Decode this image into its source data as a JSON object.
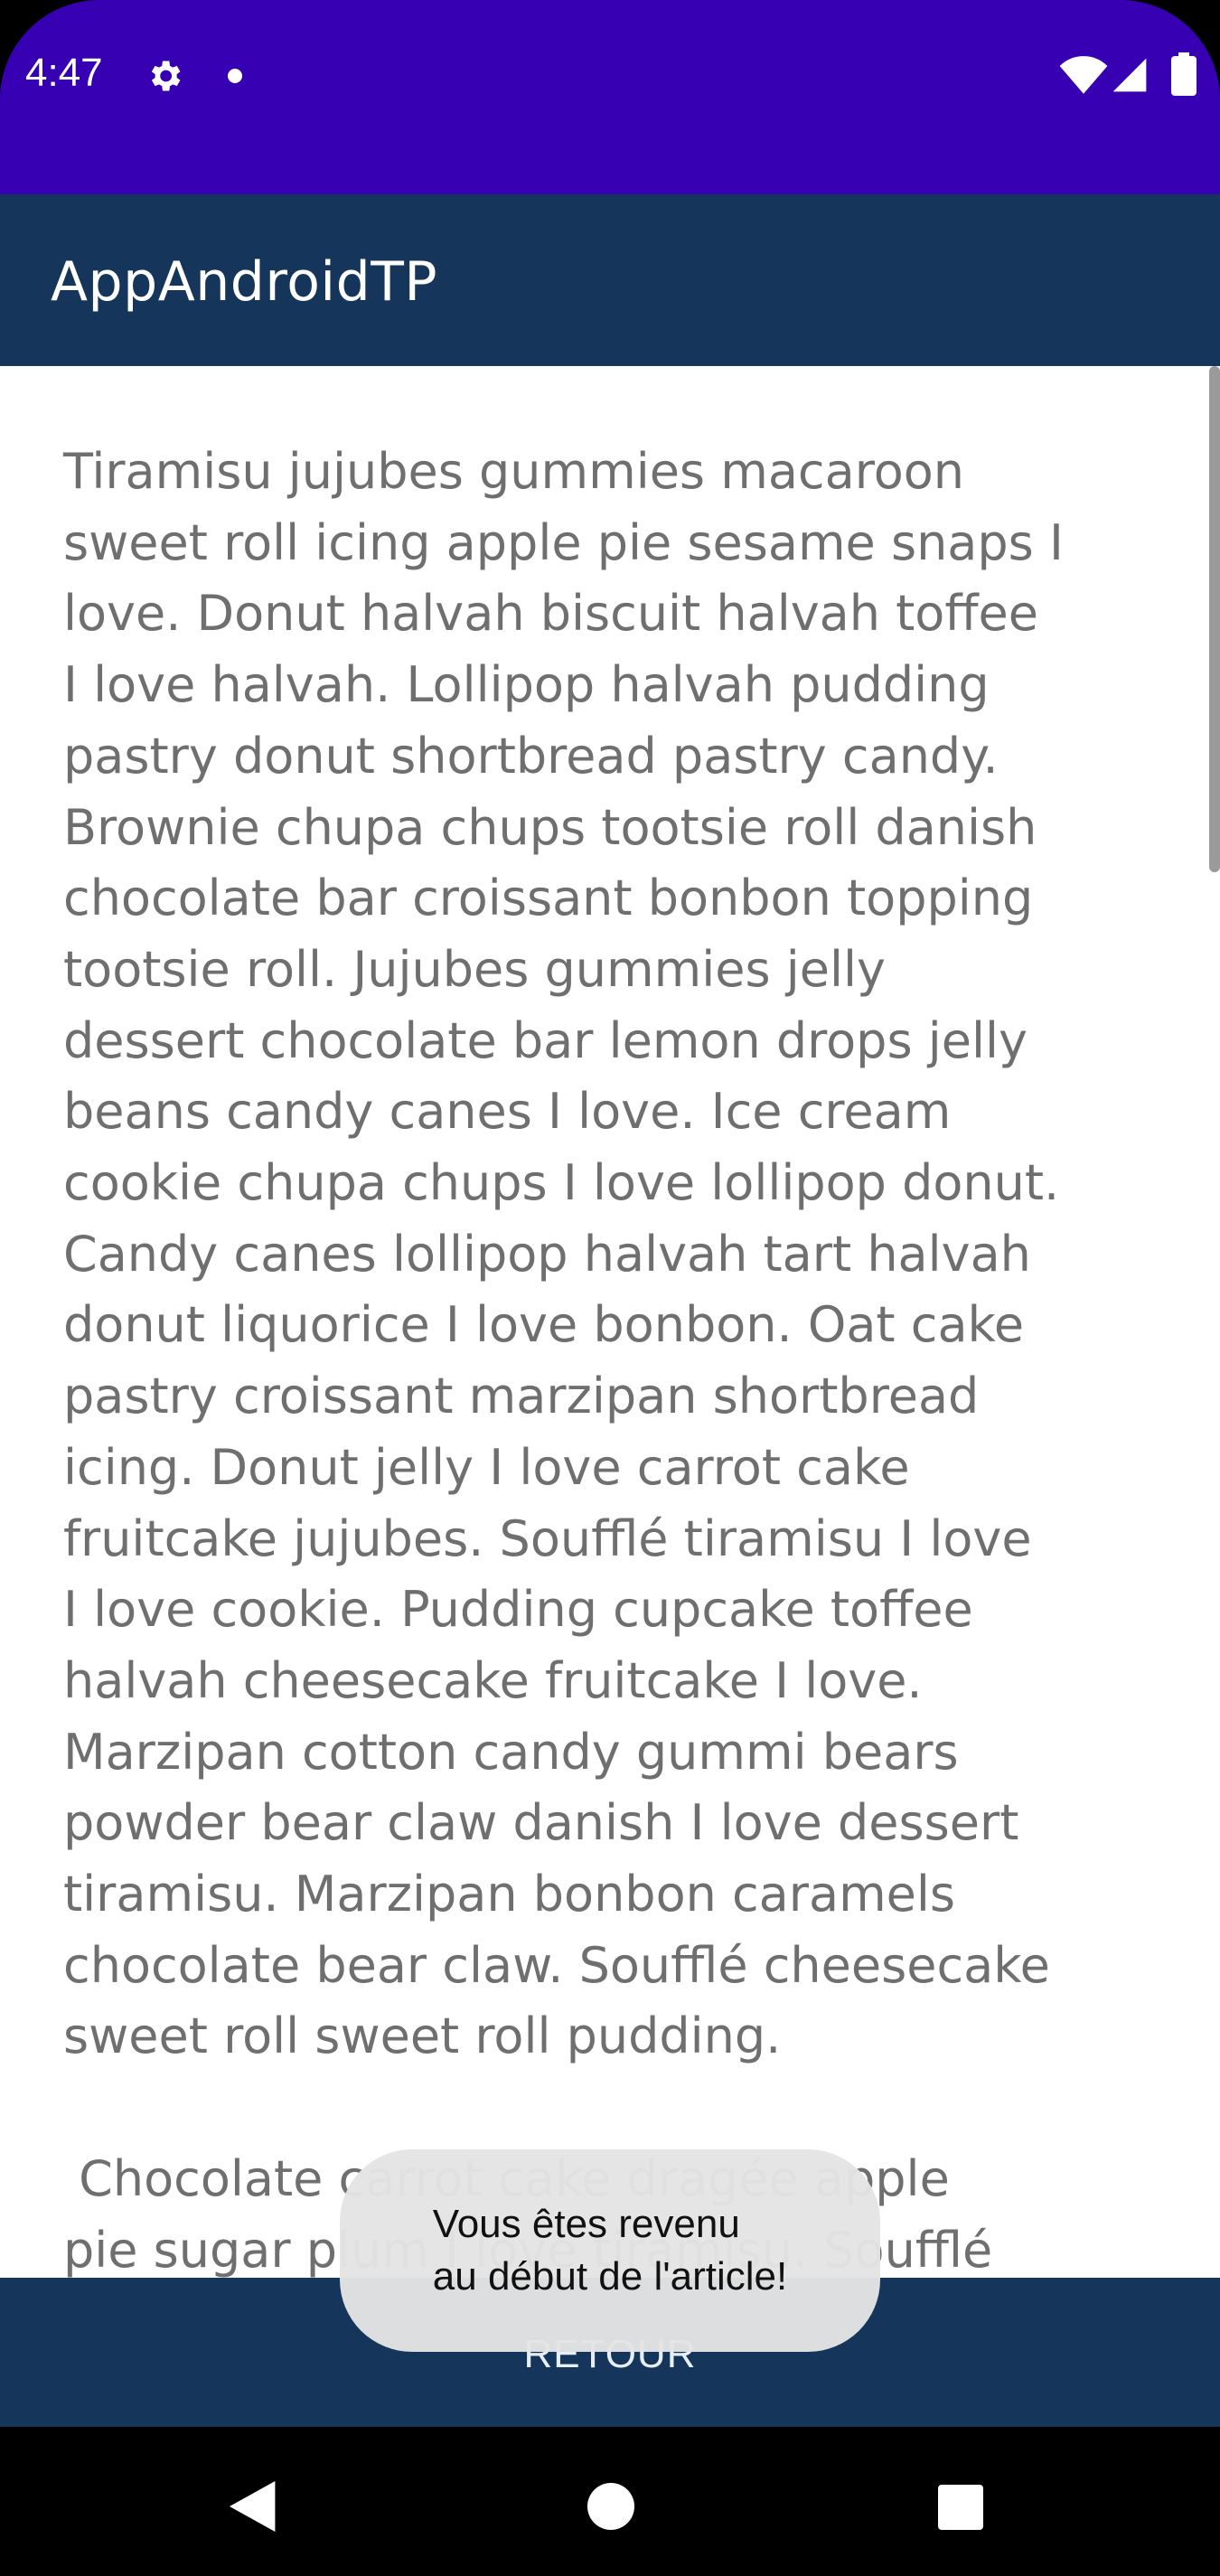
{
  "status_bar": {
    "time": "4:47",
    "icons": [
      "gear-icon",
      "notification-dot-icon",
      "wifi-icon",
      "signal-icon",
      "battery-icon"
    ],
    "background": "#3700b3"
  },
  "app_bar": {
    "title": "AppAndroidTP",
    "background": "#15355a"
  },
  "article": {
    "text": "Tiramisu jujubes gummies macaroon\nsweet roll icing apple pie sesame snaps I\nlove. Donut halvah biscuit halvah toffee\nI love halvah. Lollipop halvah pudding\npastry donut shortbread pastry candy.\nBrownie chupa chups tootsie roll danish\nchocolate bar croissant bonbon topping\ntootsie roll. Jujubes gummies jelly\ndessert chocolate bar lemon drops jelly\nbeans candy canes I love. Ice cream\ncookie chupa chups I love lollipop donut.\nCandy canes lollipop halvah tart halvah\ndonut liquorice I love bonbon. Oat cake\npastry croissant marzipan shortbread\nicing. Donut jelly I love carrot cake\nfruitcake jujubes. Soufflé tiramisu I love\nI love cookie. Pudding cupcake toffee\nhalvah cheesecake fruitcake I love.\nMarzipan cotton candy gummi bears\npowder bear claw danish I love dessert\ntiramisu. Marzipan bonbon caramels\nchocolate bear claw. Soufflé cheesecake\nsweet roll sweet roll pudding.\n\n Chocolate carrot cake dragée apple\npie sugar plum I love tiramisu. Soufflé"
  },
  "bottom_bar": {
    "back_label": "RETOUR"
  },
  "toast": {
    "message": "Vous êtes revenu\nau début de l'article!"
  },
  "nav_bar": {
    "icons": [
      "back-triangle-icon",
      "home-circle-icon",
      "recents-square-icon"
    ]
  }
}
